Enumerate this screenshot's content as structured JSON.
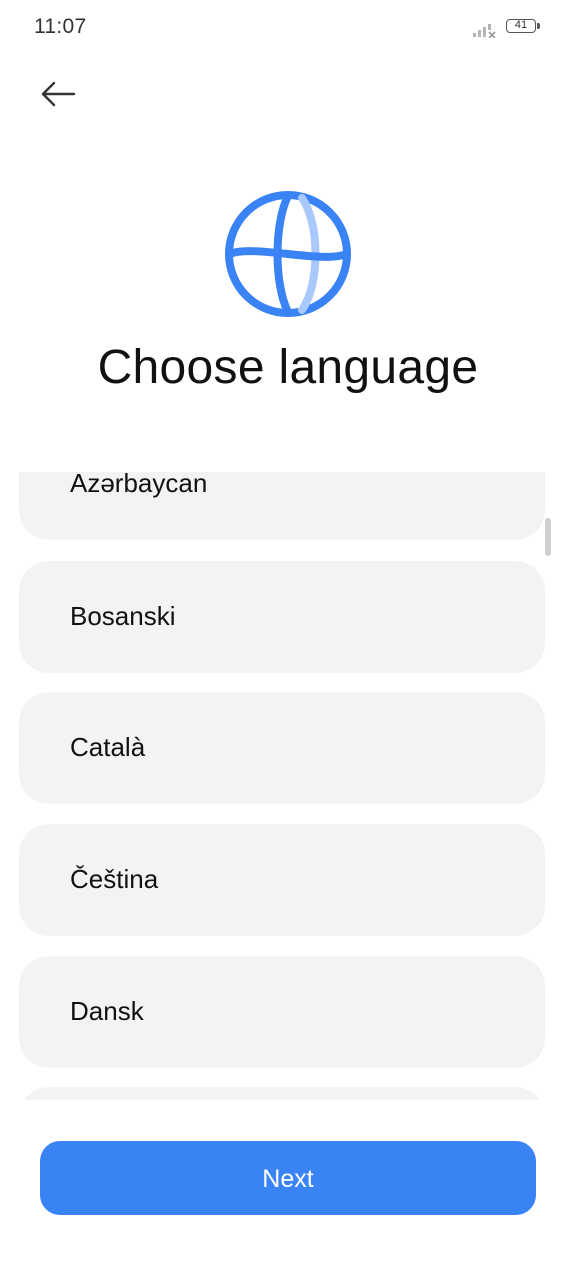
{
  "status_bar": {
    "time": "11:07",
    "battery_level": "41",
    "signal_icon": "signal-off-icon",
    "battery_icon": "battery-icon"
  },
  "header": {
    "back_icon": "arrow-left-icon",
    "globe_icon": "globe-icon",
    "title": "Choose language"
  },
  "languages": [
    {
      "label": "Azərbaycan"
    },
    {
      "label": "Bosanski"
    },
    {
      "label": "Català"
    },
    {
      "label": "Čeština"
    },
    {
      "label": "Dansk"
    },
    {
      "label": ""
    }
  ],
  "footer": {
    "next_label": "Next"
  },
  "colors": {
    "accent": "#3a83f5",
    "accent_light": "#a9c8fb",
    "item_background": "#f3f3f3"
  }
}
